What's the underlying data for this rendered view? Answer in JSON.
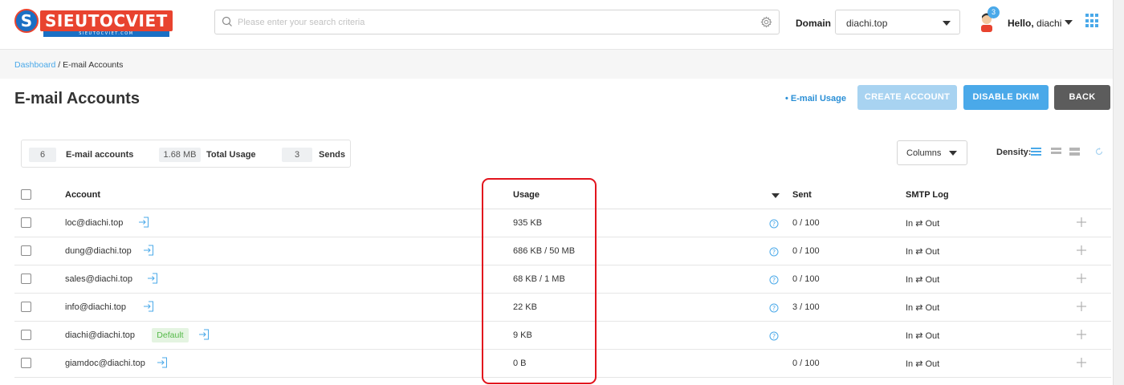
{
  "brand": {
    "logo_letter": "S",
    "logo_text": "SIEUTOCVIET",
    "logo_sub": "SIEUTOCVIET.COM"
  },
  "search": {
    "placeholder": "Please enter your search criteria"
  },
  "domain": {
    "label": "Domain",
    "value": "diachi.top"
  },
  "user": {
    "notifications": "3",
    "greeting": "Hello,",
    "name": "diachi"
  },
  "breadcrumb": {
    "home": "Dashboard",
    "separator": " / ",
    "current": "E-mail Accounts"
  },
  "page": {
    "title": "E-mail Accounts"
  },
  "actions": {
    "usage_link": "• E-mail Usage",
    "create": "CREATE ACCOUNT",
    "dkim": "DISABLE DKIM",
    "back": "BACK"
  },
  "stats": {
    "accounts_value": "6",
    "accounts_label": "E-mail accounts",
    "usage_value": "1.68 MB",
    "usage_label": "Total Usage",
    "sends_value": "3",
    "sends_label": "Sends"
  },
  "toolbar": {
    "columns": "Columns",
    "density": "Density:"
  },
  "table": {
    "headers": {
      "account": "Account",
      "usage": "Usage",
      "sent": "Sent",
      "smtp": "SMTP Log"
    },
    "default_badge": "Default",
    "rows": [
      {
        "account": "loc@diachi.top",
        "usage": "935 KB",
        "sent": "0 / 100",
        "smtp": "In ⇄ Out",
        "is_default": false,
        "help": true
      },
      {
        "account": "dung@diachi.top",
        "usage": "686 KB / 50 MB",
        "sent": "0 / 100",
        "smtp": "In ⇄ Out",
        "is_default": false,
        "help": true
      },
      {
        "account": "sales@diachi.top",
        "usage": "68 KB / 1 MB",
        "sent": "0 / 100",
        "smtp": "In ⇄ Out",
        "is_default": false,
        "help": true
      },
      {
        "account": "info@diachi.top",
        "usage": "22 KB",
        "sent": "3 / 100",
        "smtp": "In ⇄ Out",
        "is_default": false,
        "help": true
      },
      {
        "account": "diachi@diachi.top",
        "usage": "9 KB",
        "sent": "",
        "smtp": "In ⇄ Out",
        "is_default": true,
        "help": true
      },
      {
        "account": "giamdoc@diachi.top",
        "usage": "0 B",
        "sent": "0 / 100",
        "smtp": "In ⇄ Out",
        "is_default": false,
        "help": false
      }
    ]
  },
  "colors": {
    "accent": "#4aa9e9",
    "brand_red": "#e8432f",
    "brand_blue": "#1a6fc4",
    "highlight": "#e2141d"
  }
}
